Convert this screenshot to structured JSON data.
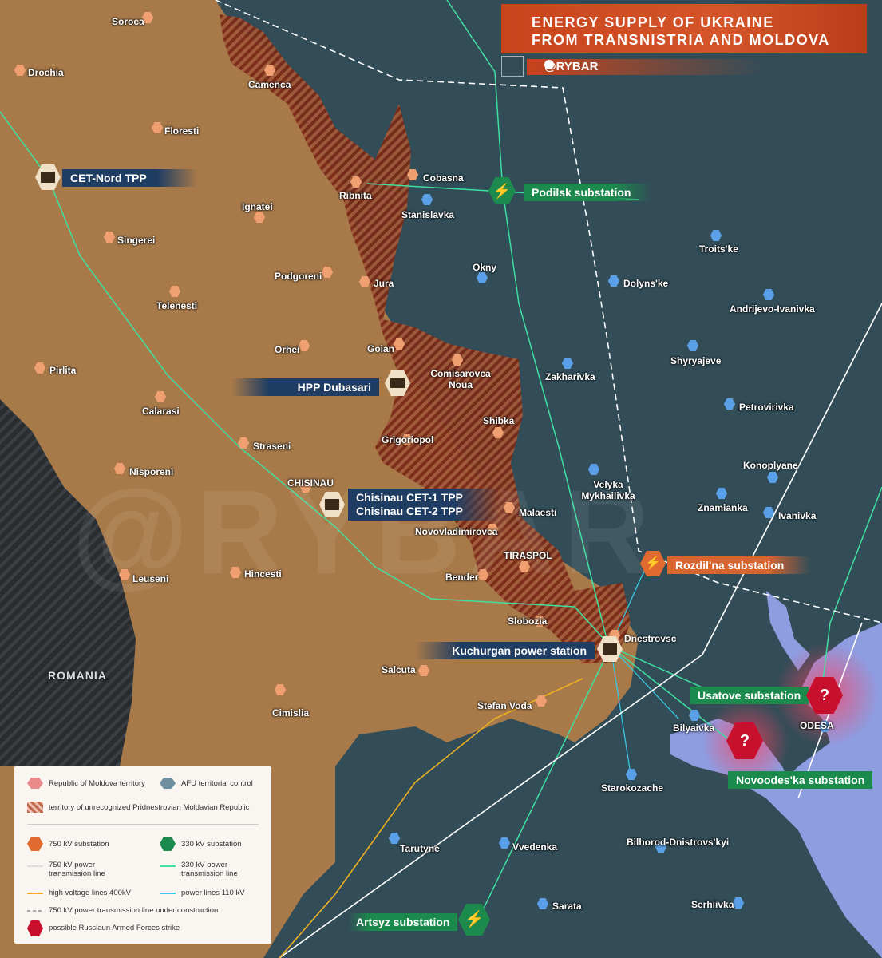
{
  "title": {
    "line1": "ENERGY SUPPLY OF UKRAINE",
    "line2": "FROM TRANSNISTRIA AND MOLDOVA"
  },
  "brand": "@RYBAR",
  "colors": {
    "moldova": "#a87a4a",
    "ukraine": "#2f4a55",
    "sea": "#8e9ce0",
    "line750": "#ffffff",
    "line330": "#3fe0a0",
    "line400": "#f0b020",
    "line110": "#3ac8e0",
    "brand": "#d4552a"
  },
  "towns": [
    {
      "name": "Soroca",
      "icon": "moldova-town-icon"
    },
    {
      "name": "Drochia",
      "icon": "moldova-town-icon"
    },
    {
      "name": "Camenca",
      "icon": "moldova-town-icon"
    },
    {
      "name": "Floresti",
      "icon": "moldova-town-icon"
    },
    {
      "name": "Cobasna",
      "icon": "moldova-town-icon"
    },
    {
      "name": "Ribnita",
      "icon": "moldova-town-icon"
    },
    {
      "name": "Stanislavka",
      "icon": "ukraine-town-icon"
    },
    {
      "name": "Ignatei",
      "icon": "moldova-town-icon"
    },
    {
      "name": "Singerei",
      "icon": "moldova-town-icon"
    },
    {
      "name": "Troits'ke",
      "icon": "ukraine-town-icon"
    },
    {
      "name": "Okny",
      "icon": "ukraine-town-icon"
    },
    {
      "name": "Podgoreni",
      "icon": "moldova-town-icon"
    },
    {
      "name": "Dolyns'ke",
      "icon": "ukraine-town-icon"
    },
    {
      "name": "Jura",
      "icon": "moldova-town-icon"
    },
    {
      "name": "Telenesti",
      "icon": "moldova-town-icon"
    },
    {
      "name": "Andrijevo-Ivanivka",
      "icon": "ukraine-town-icon"
    },
    {
      "name": "Orhei",
      "icon": "moldova-town-icon"
    },
    {
      "name": "Goian",
      "icon": "moldova-town-icon"
    },
    {
      "name": "Shyryajeve",
      "icon": "ukraine-town-icon"
    },
    {
      "name": "Pirlita",
      "icon": "moldova-town-icon"
    },
    {
      "name": "Comisarovca Noua",
      "icon": "moldova-town-icon"
    },
    {
      "name": "Zakharivka",
      "icon": "ukraine-town-icon"
    },
    {
      "name": "Petrovirivka",
      "icon": "ukraine-town-icon"
    },
    {
      "name": "Calarasi",
      "icon": "moldova-town-icon"
    },
    {
      "name": "Shibka",
      "icon": "moldova-town-icon"
    },
    {
      "name": "Grigoriopol",
      "icon": "moldova-town-icon"
    },
    {
      "name": "Straseni",
      "icon": "moldova-town-icon"
    },
    {
      "name": "Konoplyane",
      "icon": "ukraine-town-icon"
    },
    {
      "name": "Nisporeni",
      "icon": "moldova-town-icon"
    },
    {
      "name": "CHISINAU",
      "icon": "moldova-town-icon"
    },
    {
      "name": "Velyka Mykhailivka",
      "icon": "ukraine-town-icon"
    },
    {
      "name": "Znamianka",
      "icon": "ukraine-town-icon"
    },
    {
      "name": "Ivanivka",
      "icon": "ukraine-town-icon"
    },
    {
      "name": "Malaesti",
      "icon": "moldova-town-icon"
    },
    {
      "name": "Novovladimirovca",
      "icon": "moldova-town-icon"
    },
    {
      "name": "TIRASPOL",
      "icon": "moldova-town-icon"
    },
    {
      "name": "Leuseni",
      "icon": "moldova-town-icon"
    },
    {
      "name": "Hincesti",
      "icon": "moldova-town-icon"
    },
    {
      "name": "Bender",
      "icon": "moldova-town-icon"
    },
    {
      "name": "Slobozia",
      "icon": "moldova-town-icon"
    },
    {
      "name": "Dnestrovsc",
      "icon": "moldova-town-icon"
    },
    {
      "name": "Salcuta",
      "icon": "moldova-town-icon"
    },
    {
      "name": "Cimislia",
      "icon": "moldova-town-icon"
    },
    {
      "name": "Stefan Voda",
      "icon": "moldova-town-icon"
    },
    {
      "name": "Bilyaivka",
      "icon": "ukraine-town-icon"
    },
    {
      "name": "ODESA",
      "icon": "ukraine-town-icon"
    },
    {
      "name": "Starokozache",
      "icon": "ukraine-town-icon"
    },
    {
      "name": "Tarutyne",
      "icon": "ukraine-town-icon"
    },
    {
      "name": "Vvedenka",
      "icon": "ukraine-town-icon"
    },
    {
      "name": "Bilhorod-Dnistrovs'kyi",
      "icon": "ukraine-town-icon"
    },
    {
      "name": "Sarata",
      "icon": "ukraine-town-icon"
    },
    {
      "name": "Serhiivka",
      "icon": "ukraine-town-icon"
    }
  ],
  "facilities": {
    "cet_nord": "CET-Nord TPP",
    "hpp_dubasari": "HPP Dubasari",
    "chisinau_cet1": "Chisinau CET-1 TPP",
    "chisinau_cet2": "Chisinau CET-2 TPP",
    "kuchurgan": "Kuchurgan power station",
    "podilsk": "Podilsk substation",
    "rozdilna": "Rozdil'na substation",
    "usatove": "Usatove substation",
    "novoodeska": "Novoodes'ka substation",
    "artsyz": "Artsyz substation"
  },
  "country_label": "ROMANIA",
  "watermark": "@RYBAR",
  "legend": {
    "moldova": "Republic of Moldova territory",
    "afu": "AFU territorial control",
    "pmr": "territory of unrecognized Pridnestrovian Moldavian Republic",
    "sub750": "750 kV substation",
    "sub330": "330 kV substation",
    "line750": "750 kV power transmission line",
    "line330": "330 kV power transmission line",
    "line400": "high voltage lines 400kV",
    "line110": "power lines 110 kV",
    "line750c": "750 kV power transmission line under construction",
    "strike": "possible Russiaun Armed Forces strike"
  }
}
